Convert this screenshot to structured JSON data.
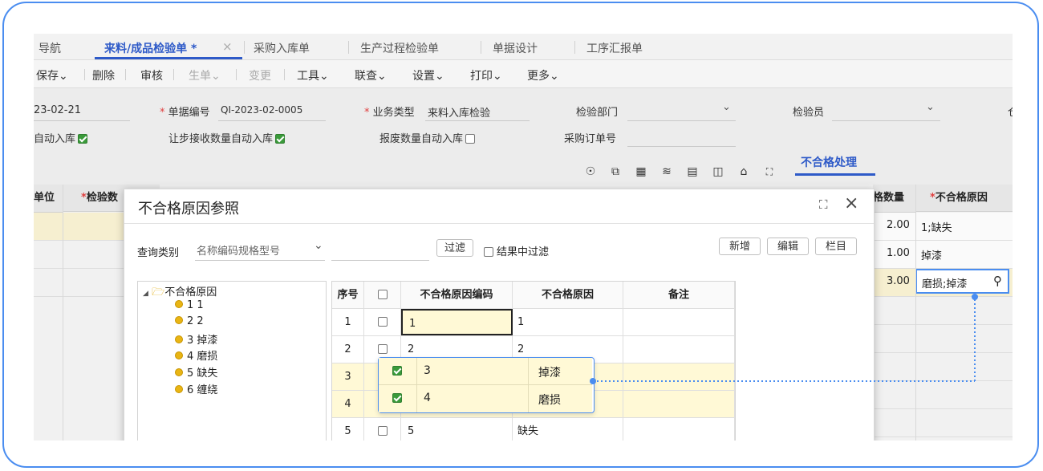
{
  "tabs": [
    {
      "label": "导航"
    },
    {
      "label": "来料/成品检验单 *"
    },
    {
      "label": "采购入库单"
    },
    {
      "label": "生产过程检验单"
    },
    {
      "label": "单据设计"
    },
    {
      "label": "工序汇报单"
    }
  ],
  "tab_close": "×",
  "toolbar": {
    "save": "保存",
    "delete": "删除",
    "audit": "审核",
    "generate": "生单",
    "change": "变更",
    "tools": "工具",
    "query": "联查",
    "settings": "设置",
    "print": "打印",
    "more": "更多",
    "chevron": "⌄"
  },
  "form": {
    "date_value": "23-02-21",
    "doc_no_label": "单据编号",
    "doc_no_value": "QI-2023-02-0005",
    "biz_type_label": "业务类型",
    "biz_type_value": "来料入库检验",
    "dept_label": "检验部门",
    "inspector_label": "检验员",
    "cut_right": "仓",
    "auto_in_label": "自动入库",
    "concession_label": "让步接收数量自动入库",
    "scrap_label": "报废数量自动入库",
    "po_label": "采购订单号",
    "required_mark": "*"
  },
  "subtab": "不合格处理",
  "grid": {
    "col_unit": "单位",
    "col_inspect_qty": "检验数",
    "col_nc_qty": "格数量",
    "col_nc_reason": "不合格原因",
    "rows": [
      {
        "qty": "2.00",
        "reason": "1;缺失"
      },
      {
        "qty": "1.00",
        "reason": "掉漆"
      },
      {
        "qty": "3.00",
        "reason": "磨损;掉漆"
      }
    ]
  },
  "modal": {
    "title": "不合格原因参照",
    "query_type_label": "查询类别",
    "query_type_value": "名称编码规格型号",
    "filter_btn": "过滤",
    "filter_in_result": "结果中过滤",
    "new_btn": "新增",
    "edit_btn": "编辑",
    "column_btn": "栏目",
    "tree_root": "不合格原因",
    "tree_items": [
      "1 1",
      "2 2",
      "3 掉漆",
      "4 磨损",
      "5 缺失",
      "6 缠绕"
    ],
    "table_headers": {
      "seq": "序号",
      "code": "不合格原因编码",
      "reason": "不合格原因",
      "remark": "备注"
    },
    "table_rows": [
      {
        "seq": "1",
        "code": "1",
        "reason": "1",
        "checked": false
      },
      {
        "seq": "2",
        "code": "2",
        "reason": "2",
        "checked": false
      },
      {
        "seq": "3",
        "code": "3",
        "reason": "掉漆",
        "checked": true
      },
      {
        "seq": "4",
        "code": "4",
        "reason": "磨损",
        "checked": true
      },
      {
        "seq": "5",
        "code": "5",
        "reason": "缺失",
        "checked": false
      }
    ]
  },
  "callout": {
    "rows": [
      {
        "code": "3",
        "reason": "掉漆"
      },
      {
        "code": "4",
        "reason": "磨损"
      }
    ]
  },
  "colors": {
    "accent": "#2e5ac8",
    "highlight": "#4a8df0",
    "selected_row": "#fff9d6",
    "check_green": "#3a9a3a"
  }
}
